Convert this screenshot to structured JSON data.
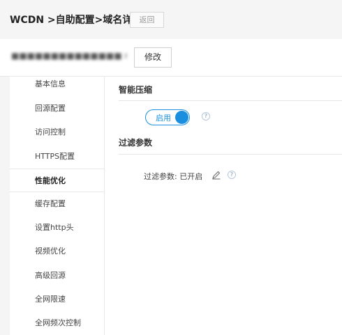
{
  "header": {
    "breadcrumb": "WCDN >自助配置>域名详情",
    "back_label": "返回"
  },
  "domain": {
    "value": "■■■■■■■■■■■■■■ n",
    "edit_label": "修改"
  },
  "sidebar": {
    "items": [
      {
        "label": "基本信息"
      },
      {
        "label": "回源配置"
      },
      {
        "label": "访问控制"
      },
      {
        "label": "HTTPS配置"
      },
      {
        "label": "性能优化"
      },
      {
        "label": "缓存配置"
      },
      {
        "label": "设置http头"
      },
      {
        "label": "视频优化"
      },
      {
        "label": "高级回源"
      },
      {
        "label": "全网限速"
      },
      {
        "label": "全网频次控制"
      }
    ],
    "active_index": 4
  },
  "main": {
    "compression": {
      "title": "智能压缩",
      "toggle_label": "启用",
      "toggle_on": true
    },
    "filter": {
      "title": "过滤参数",
      "status_label": "过滤参数:",
      "status_value": "已开启"
    }
  },
  "icons": {
    "help": "question-circle-icon",
    "edit": "pencil-icon"
  },
  "colors": {
    "accent": "#1a8fe0"
  }
}
